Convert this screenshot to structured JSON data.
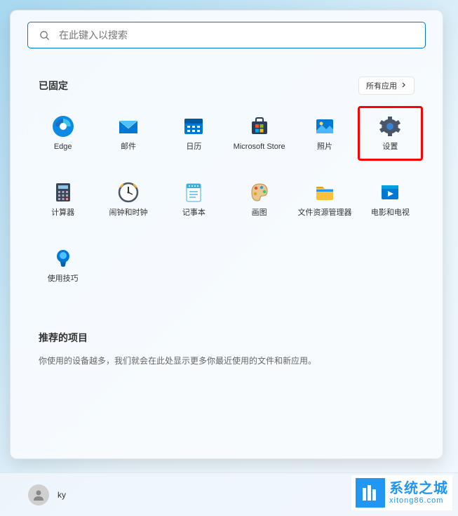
{
  "search": {
    "placeholder": "在此键入以搜索"
  },
  "pinned": {
    "title": "已固定",
    "all_apps_label": "所有应用",
    "apps": [
      {
        "name": "Edge",
        "icon": "edge"
      },
      {
        "name": "邮件",
        "icon": "mail"
      },
      {
        "name": "日历",
        "icon": "calendar"
      },
      {
        "name": "Microsoft Store",
        "icon": "store"
      },
      {
        "name": "照片",
        "icon": "photos"
      },
      {
        "name": "设置",
        "icon": "settings",
        "highlighted": true
      },
      {
        "name": "计算器",
        "icon": "calculator"
      },
      {
        "name": "闹钟和时钟",
        "icon": "clock"
      },
      {
        "name": "记事本",
        "icon": "notepad"
      },
      {
        "name": "画图",
        "icon": "paint"
      },
      {
        "name": "文件资源管理器",
        "icon": "explorer"
      },
      {
        "name": "电影和电视",
        "icon": "movies"
      },
      {
        "name": "使用技巧",
        "icon": "tips"
      }
    ]
  },
  "recommended": {
    "title": "推荐的项目",
    "description": "你使用的设备越多，我们就会在此处显示更多你最近使用的文件和新应用。"
  },
  "user": {
    "name": "ky"
  },
  "watermark": {
    "title": "系统之城",
    "url": "xitong86.com"
  }
}
